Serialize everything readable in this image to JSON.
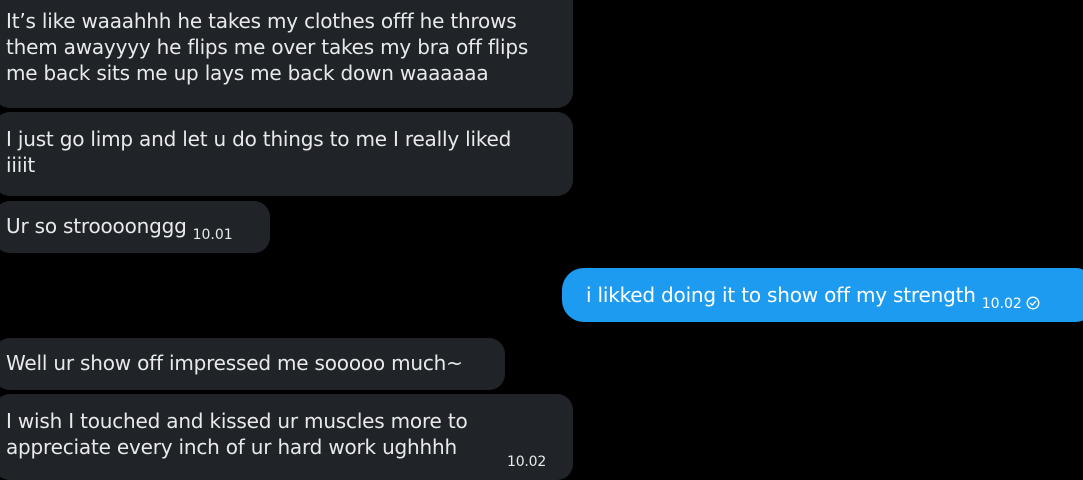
{
  "messages": [
    {
      "direction": "incoming",
      "text": "It’s like waaahhh he takes my clothes offf he throws them awayyyy he flips me over takes my bra off flips me back sits me up lays me back down waaaaaa",
      "lines": [
        "It’s like waaahhh he takes my clothes offf he throws",
        "them awayyyy he flips me over takes my bra off flips",
        "me back sits me up lays me back down waaaaaa"
      ]
    },
    {
      "direction": "incoming",
      "text": "I just go limp and let u do things to me I really liked iiiit",
      "lines": [
        "I just go limp and let u do things to me I really liked",
        "iiiit"
      ]
    },
    {
      "direction": "incoming",
      "text": "Ur so stroooonggg",
      "time": "10.01"
    },
    {
      "direction": "outgoing",
      "text": "i likked doing it to show off my strength",
      "time": "10.02",
      "status": "sent-check-icon"
    },
    {
      "direction": "incoming",
      "text": "Well ur show off impressed me sooooo much~"
    },
    {
      "direction": "incoming",
      "text": "I wish I touched and kissed ur muscles more to appreciate every inch of ur hard work ughhhh",
      "lines": [
        "I wish I touched and kissed ur muscles more to",
        "appreciate every inch of ur hard work ughhhh"
      ],
      "time": "10.02"
    }
  ],
  "colors": {
    "background": "#000000",
    "incoming_bubble": "#202327",
    "outgoing_bubble": "#1d9bf0",
    "text": "#e7e9ea"
  }
}
